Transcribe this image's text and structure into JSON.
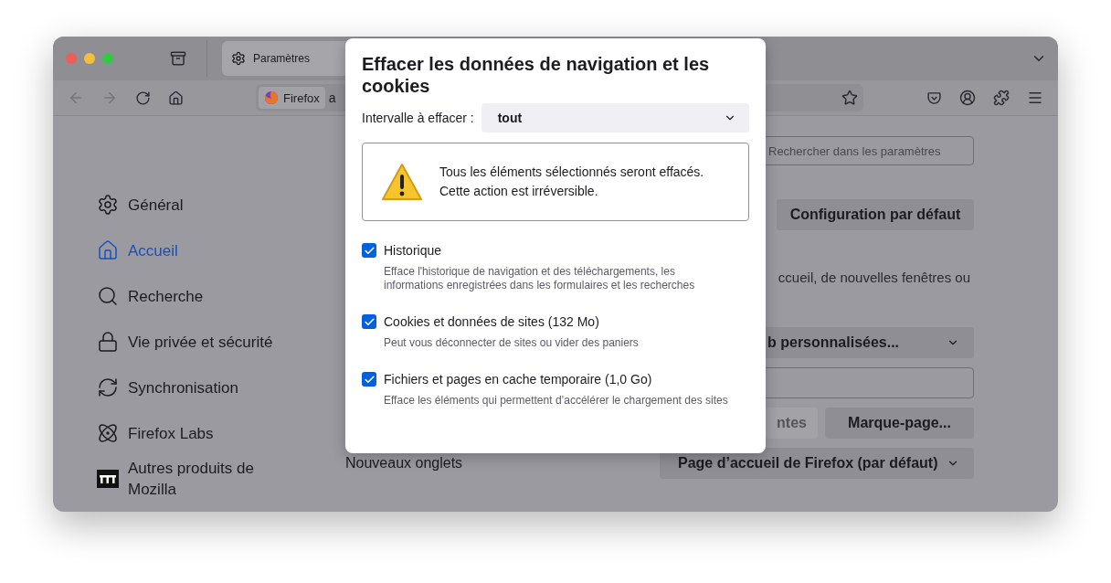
{
  "window": {
    "tab": {
      "title": "Paramètres",
      "selected": true
    },
    "navigation": {
      "back": {
        "disabled": true
      },
      "forward": {
        "disabled": true
      }
    },
    "address_bar": {
      "identity": "Firefox",
      "url": "a"
    }
  },
  "sidebar": {
    "items": [
      {
        "label": "Général",
        "selected": false
      },
      {
        "label": "Accueil",
        "selected": true
      },
      {
        "label": "Recherche",
        "selected": false
      },
      {
        "label": "Vie privée et sécurité",
        "selected": false
      },
      {
        "label": "Synchronisation",
        "selected": false
      },
      {
        "label": "Firefox Labs",
        "selected": false
      },
      {
        "label": "Autres produits de Mozilla",
        "selected": false
      }
    ]
  },
  "settings": {
    "search": {
      "placeholder": "Rechercher dans les paramètres"
    },
    "restore_button": "Configuration par défaut",
    "description": "ccueil, de nouvelles fenêtres ou",
    "homepage_select": "b personnalisées...",
    "buttons": [
      {
        "label": "ntes",
        "disabled": true
      },
      {
        "label": "Marque-page...",
        "disabled": false
      }
    ],
    "new_tabs": {
      "label": "Nouveaux onglets",
      "value": "Page d’accueil de Firefox (par défaut)"
    }
  },
  "dialog": {
    "title": "Effacer les données de navigation et les cookies",
    "range": {
      "label": "Intervalle à effacer :",
      "value": "tout"
    },
    "warning": [
      "Tous les éléments sélectionnés seront effacés.",
      "Cette action est irréversible."
    ],
    "options": [
      {
        "label": "Historique",
        "description": "Efface l'historique de navigation et des téléchargements, les informations enregistrées dans les formulaires et les recherches",
        "checked": true
      },
      {
        "label": "Cookies et données de sites (132 Mo)",
        "description": "Peut vous déconnecter de sites ou vider des paniers",
        "checked": true
      },
      {
        "label": "Fichiers et pages en cache temporaire (1,0 Go)",
        "description": "Efface les éléments qui permettent d’accélérer le chargement des sites",
        "checked": true
      }
    ]
  }
}
